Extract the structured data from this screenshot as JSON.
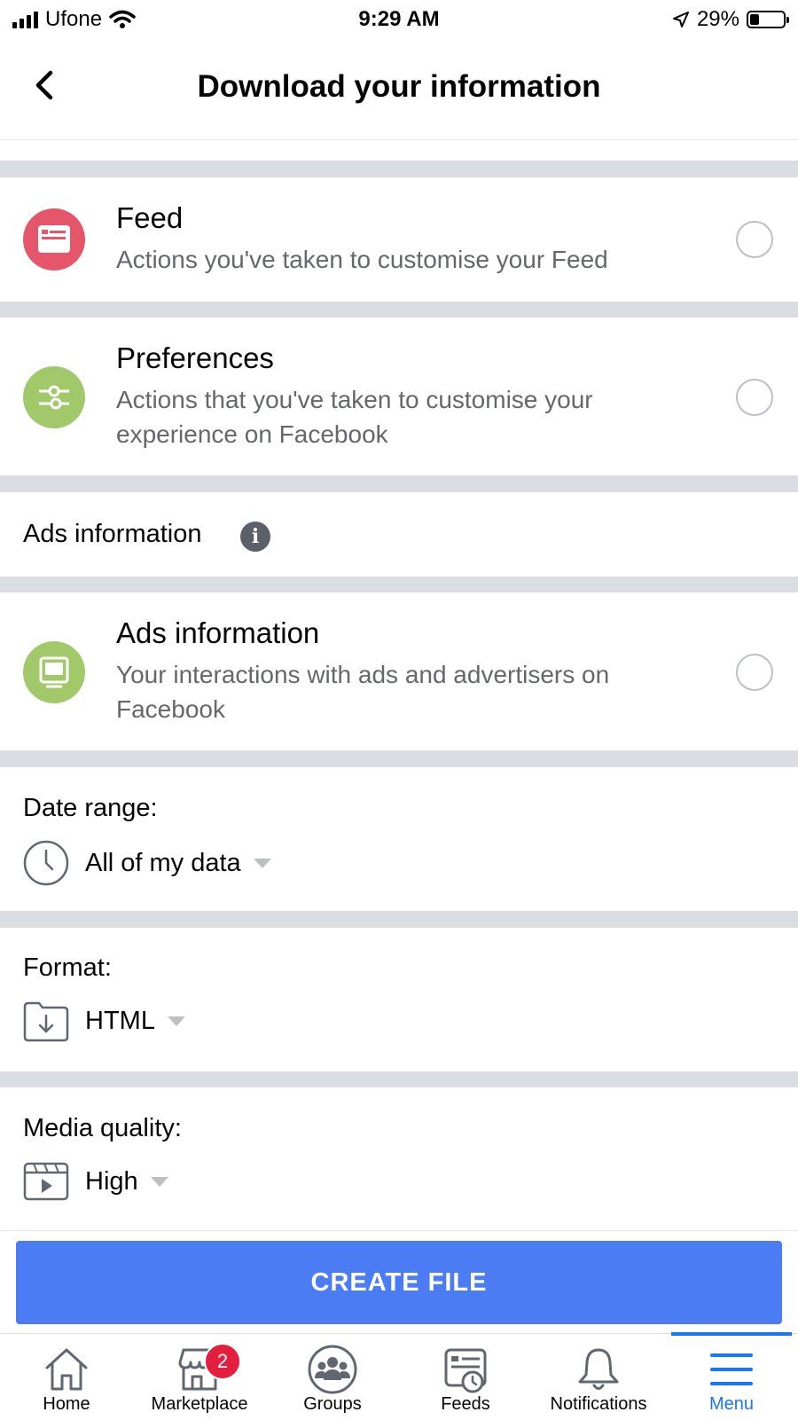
{
  "status_bar": {
    "carrier": "Ufone",
    "time": "9:29 AM",
    "battery": "29%",
    "battery_level": 0.29
  },
  "header": {
    "title": "Download your information",
    "back_icon": "chevron-left-icon"
  },
  "options": [
    {
      "title": "Feed",
      "description": "Actions you've taken to customise your Feed",
      "icon": "feed-icon",
      "icon_color": "#e5566a",
      "selected": false
    },
    {
      "title": "Preferences",
      "description": "Actions that you've taken to customise your experience on Facebook",
      "icon": "sliders-icon",
      "icon_color": "#a2c969",
      "selected": false
    },
    {
      "title": "Ads information",
      "description": "Your interactions with ads and advertisers on Facebook",
      "icon": "monitor-icon",
      "icon_color": "#a2c969",
      "selected": false
    }
  ],
  "ads_section": {
    "label": "Ads information",
    "info_glyph": "i"
  },
  "date_range": {
    "label": "Date range:",
    "value": "All of my data"
  },
  "format": {
    "label": "Format:",
    "value": "HTML"
  },
  "media_quality": {
    "label": "Media quality:",
    "value": "High"
  },
  "create_button": "CREATE FILE",
  "bottom_nav": {
    "items": [
      {
        "label": "Home",
        "icon": "home-icon"
      },
      {
        "label": "Marketplace",
        "icon": "marketplace-icon",
        "badge": "2"
      },
      {
        "label": "Groups",
        "icon": "groups-icon"
      },
      {
        "label": "Feeds",
        "icon": "feeds-icon"
      },
      {
        "label": "Notifications",
        "icon": "bell-icon"
      },
      {
        "label": "Menu",
        "icon": "menu-icon",
        "active": true
      }
    ],
    "active_color": "#1877f2"
  }
}
